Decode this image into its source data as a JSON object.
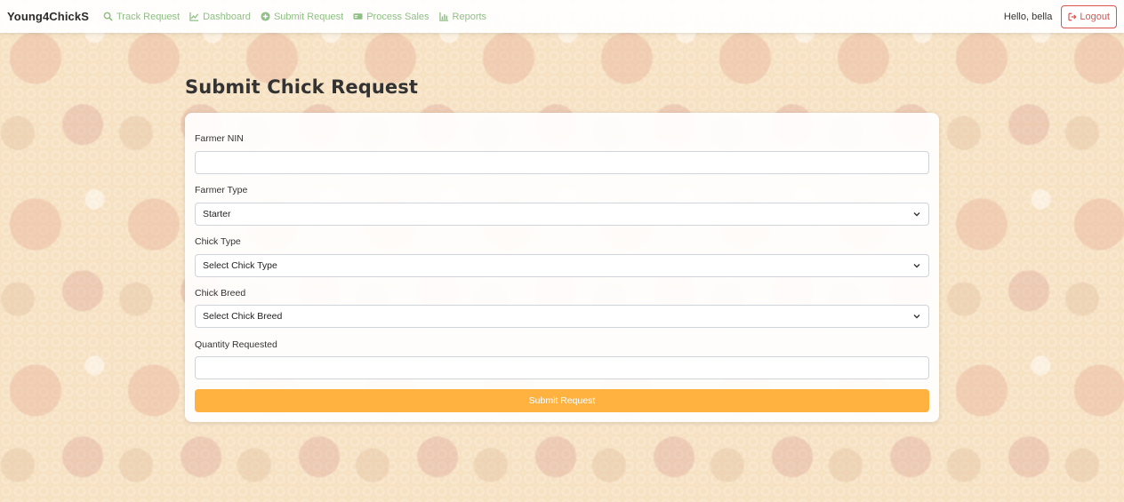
{
  "brand": "Young4ChickS",
  "nav": {
    "items": [
      {
        "label": "Track Request",
        "icon": "search-icon"
      },
      {
        "label": "Dashboard",
        "icon": "chart-line-icon"
      },
      {
        "label": "Submit Request",
        "icon": "plus-circle-icon"
      },
      {
        "label": "Process Sales",
        "icon": "money-bill-icon"
      },
      {
        "label": "Reports",
        "icon": "chart-bar-icon"
      }
    ],
    "link_color": "#8fbf85",
    "greeting": "Hello, bella",
    "logout_label": "Logout",
    "logout_icon": "sign-out-icon"
  },
  "page": {
    "title": "Submit Chick Request"
  },
  "form": {
    "farmer_nin": {
      "label": "Farmer NIN",
      "value": ""
    },
    "farmer_type": {
      "label": "Farmer Type",
      "value": "Starter"
    },
    "chick_type": {
      "label": "Chick Type",
      "value": "Select Chick Type"
    },
    "chick_breed": {
      "label": "Chick Breed",
      "value": "Select Chick Breed"
    },
    "quantity": {
      "label": "Quantity Requested",
      "value": ""
    },
    "submit_label": "Submit Request",
    "submit_color": "#ffb240"
  }
}
